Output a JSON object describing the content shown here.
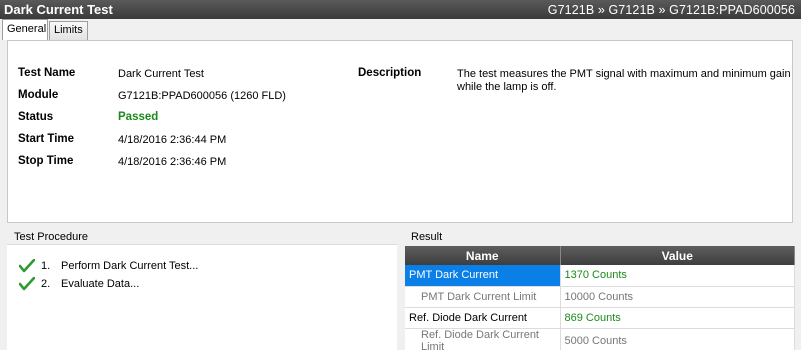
{
  "window": {
    "title": "Dark Current Test",
    "breadcrumb": "G7121B » G7121B » G7121B:PPAD600056"
  },
  "tabs": [
    {
      "label": "General",
      "active": true
    },
    {
      "label": "Limits",
      "active": false
    }
  ],
  "info": {
    "test_name_label": "Test Name",
    "test_name": "Dark Current Test",
    "module_label": "Module",
    "module": "G7121B:PPAD600056 (1260 FLD)",
    "status_label": "Status",
    "status": "Passed",
    "start_time_label": "Start Time",
    "start_time": "4/18/2016 2:36:44 PM",
    "stop_time_label": "Stop Time",
    "stop_time": "4/18/2016 2:36:46 PM",
    "description_label": "Description",
    "description_line1": "The test measures the PMT signal with maximum and minimum gain",
    "description_line2": "while the lamp is off."
  },
  "procedure": {
    "label": "Test Procedure",
    "steps": [
      {
        "num": "1.",
        "text": "Perform Dark Current Test...",
        "done": true
      },
      {
        "num": "2.",
        "text": "Evaluate Data...",
        "done": true
      }
    ]
  },
  "result": {
    "label": "Result",
    "columns": [
      "Name",
      "Value"
    ],
    "rows": [
      {
        "name": "PMT Dark Current",
        "value": "1370 Counts"
      },
      {
        "name": "PMT Dark Current Limit",
        "value": "10000 Counts"
      },
      {
        "name": "Ref. Diode Dark Current",
        "value": "869 Counts"
      },
      {
        "name": "Ref. Diode Dark Current Limit",
        "value": "5000 Counts"
      }
    ]
  },
  "colors": {
    "pass": "#1b8a1b",
    "selection": "#0a7fe8",
    "header": "#4a4a4a"
  }
}
